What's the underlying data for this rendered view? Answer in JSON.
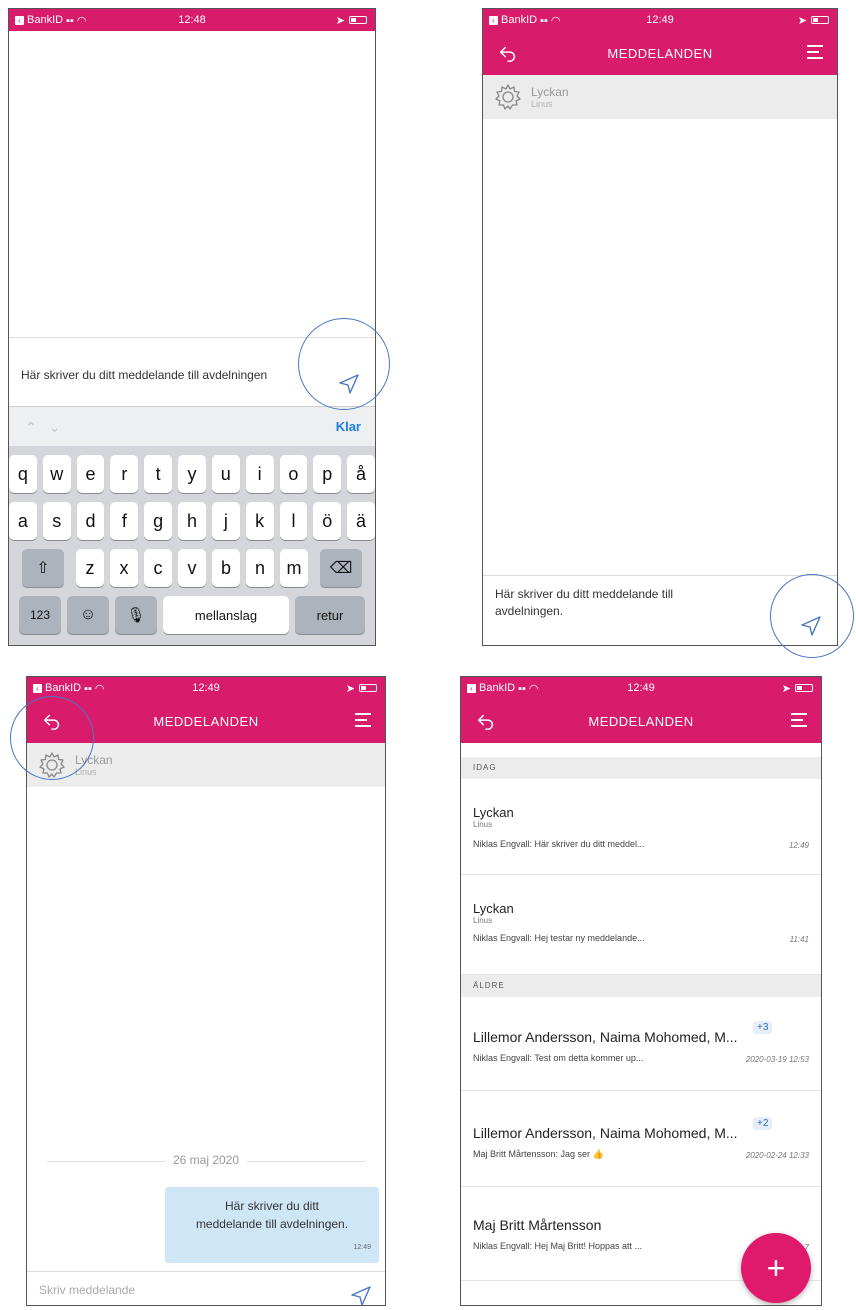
{
  "status_bar": {
    "carrier": "BankID",
    "time_1": "12:48",
    "time_2": "12:49",
    "time_3": "12:49",
    "time_4": "12:49"
  },
  "header": {
    "title": "MEDDELANDEN"
  },
  "conversation": {
    "name": "Lyckan",
    "sub": "Linus"
  },
  "screen1": {
    "draft_text": "Här skriver du ditt meddelande till avdelningen",
    "done_label": "Klar",
    "keyboard_rows": [
      [
        "q",
        "w",
        "e",
        "r",
        "t",
        "y",
        "u",
        "i",
        "o",
        "p",
        "å"
      ],
      [
        "a",
        "s",
        "d",
        "f",
        "g",
        "h",
        "j",
        "k",
        "l",
        "ö",
        "ä"
      ],
      [
        "z",
        "x",
        "c",
        "v",
        "b",
        "n",
        "m"
      ]
    ],
    "num_key": "123",
    "space_key": "mellanslag",
    "return_key": "retur"
  },
  "screen2": {
    "draft_line1": "Här skriver du ditt meddelande till",
    "draft_line2": "avdelningen."
  },
  "screen3": {
    "date_divider": "26 maj 2020",
    "bubble_line1": "Här skriver du ditt",
    "bubble_line2": "meddelande till avdelningen.",
    "bubble_time": "12:49",
    "composer_placeholder": "Skriv meddelande"
  },
  "screen4": {
    "section_today": "IDAG",
    "section_older": "ÄLDRE",
    "rows": [
      {
        "title": "Lyckan",
        "sub": "Linus",
        "msg": "Niklas Engvall: Här skriver du ditt meddel...",
        "date": "12:49"
      },
      {
        "title": "Lyckan",
        "sub": "Linus",
        "msg": "Niklas Engvall: Hej testar ny meddelande...",
        "date": "11:41"
      },
      {
        "title": "Lillemor Andersson, Naima Mohomed, M...",
        "badge": "+3",
        "msg": "Niklas Engvall: Test om detta kommer up...",
        "date": "2020-03-19 12:53"
      },
      {
        "title": "Lillemor Andersson, Naima Mohomed, M...",
        "badge": "+2",
        "msg": "Maj Britt Mårtensson: Jag ser 👍",
        "date": "2020-02-24 12:33"
      },
      {
        "title": "Maj Britt Mårtensson",
        "msg": "Niklas Engvall: Hej Maj Britt! Hoppas att ...",
        "date": "202...7"
      }
    ],
    "fab_label": "+"
  },
  "colors": {
    "brand": "#d81b6a",
    "highlight_circle": "#4b76c2",
    "bubble": "#cfe6f7"
  }
}
